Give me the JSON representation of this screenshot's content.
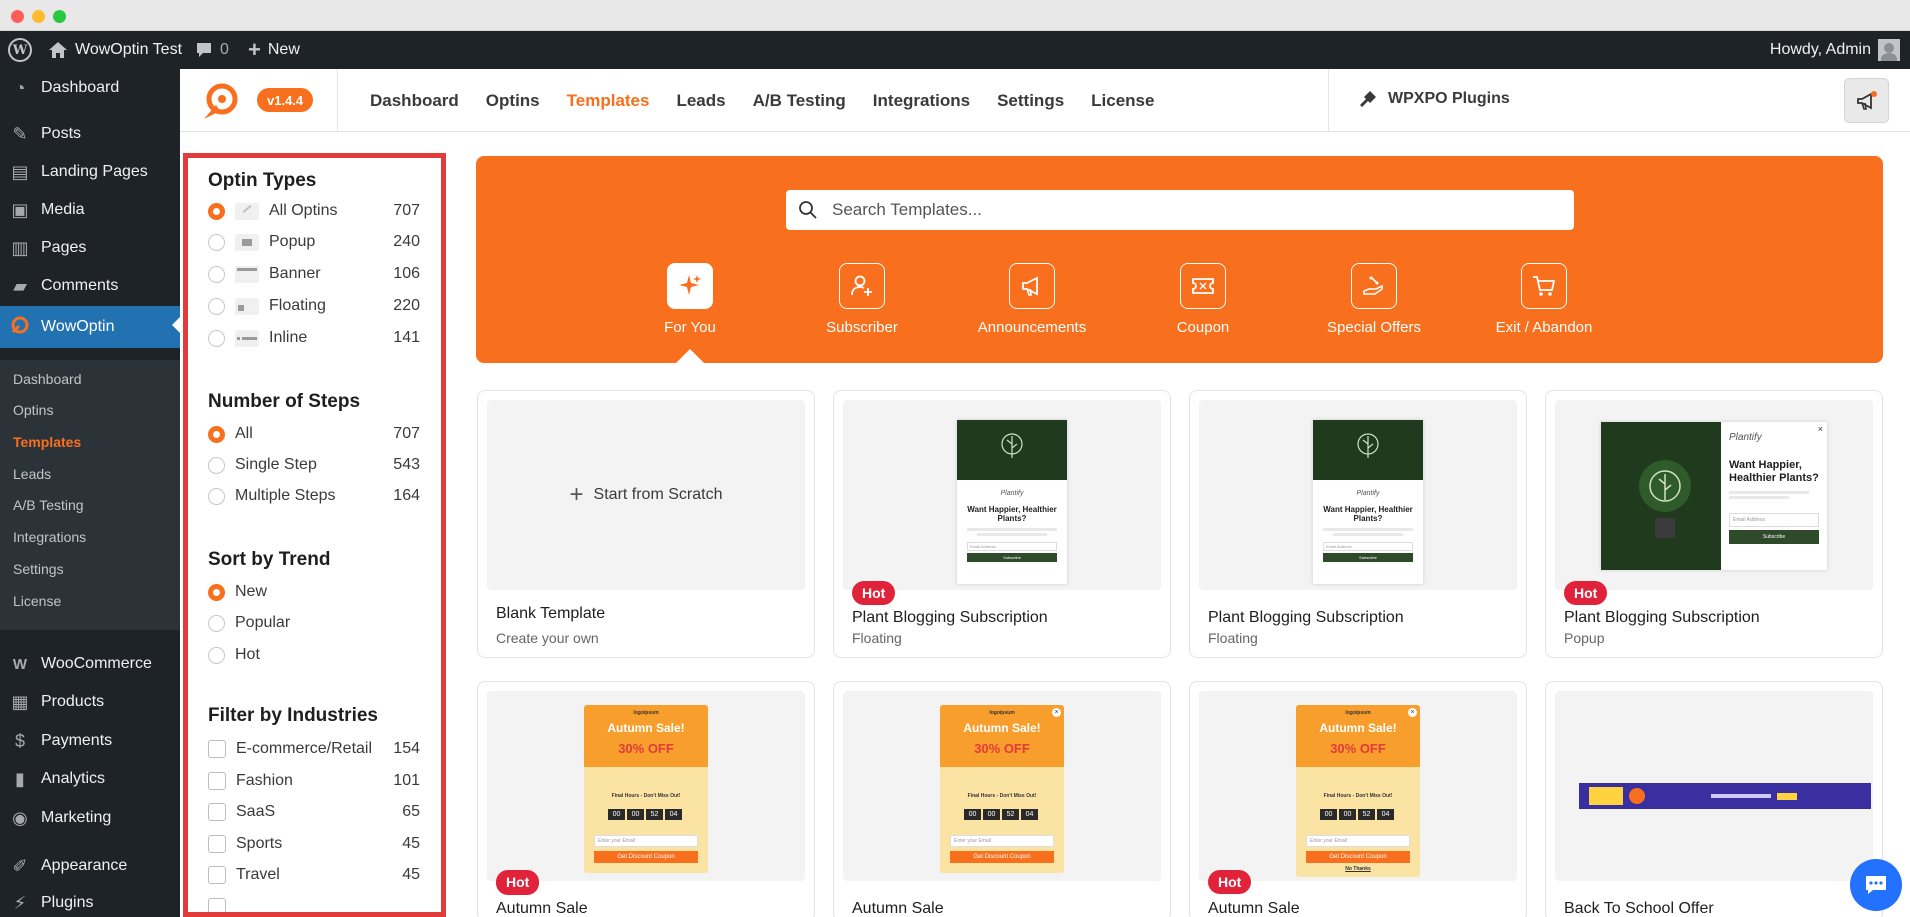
{
  "adminbar": {
    "site_name": "WowOptin Test",
    "comments_count": "0",
    "new_label": "New",
    "howdy": "Howdy, Admin"
  },
  "wp_menu": {
    "items": [
      {
        "label": "Dashboard",
        "icon": "dashboard-icon"
      },
      {
        "label": "Posts",
        "icon": "pin-icon"
      },
      {
        "label": "Landing Pages",
        "icon": "pages-icon"
      },
      {
        "label": "Media",
        "icon": "media-icon"
      },
      {
        "label": "Pages",
        "icon": "page-icon"
      },
      {
        "label": "Comments",
        "icon": "comment-icon"
      },
      {
        "label": "WowOptin",
        "icon": "wowoptin-icon"
      }
    ],
    "submenu": [
      "Dashboard",
      "Optins",
      "Templates",
      "Leads",
      "A/B Testing",
      "Integrations",
      "Settings",
      "License"
    ],
    "items2": [
      {
        "label": "WooCommerce",
        "icon": "woocommerce-icon"
      },
      {
        "label": "Products",
        "icon": "products-icon"
      },
      {
        "label": "Payments",
        "icon": "payments-icon"
      },
      {
        "label": "Analytics",
        "icon": "analytics-icon"
      },
      {
        "label": "Marketing",
        "icon": "marketing-icon"
      },
      {
        "label": "Appearance",
        "icon": "appearance-icon"
      },
      {
        "label": "Plugins",
        "icon": "plugins-icon"
      }
    ]
  },
  "plugin_header": {
    "version": "v1.4.4",
    "tabs": [
      "Dashboard",
      "Optins",
      "Templates",
      "Leads",
      "A/B Testing",
      "Integrations",
      "Settings",
      "License"
    ],
    "active_tab": "Templates",
    "wpxpo": "WPXPO Plugins"
  },
  "filters": {
    "optin_types_title": "Optin Types",
    "optin_types": [
      {
        "label": "All Optins",
        "count": "707",
        "selected": true
      },
      {
        "label": "Popup",
        "count": "240"
      },
      {
        "label": "Banner",
        "count": "106"
      },
      {
        "label": "Floating",
        "count": "220"
      },
      {
        "label": "Inline",
        "count": "141"
      }
    ],
    "steps_title": "Number of Steps",
    "steps": [
      {
        "label": "All",
        "count": "707",
        "selected": true
      },
      {
        "label": "Single Step",
        "count": "543"
      },
      {
        "label": "Multiple Steps",
        "count": "164"
      }
    ],
    "trend_title": "Sort by Trend",
    "trend": [
      {
        "label": "New",
        "selected": true
      },
      {
        "label": "Popular"
      },
      {
        "label": "Hot"
      }
    ],
    "industries_title": "Filter by Industries",
    "industries": [
      {
        "label": "E-commerce/Retail",
        "count": "154"
      },
      {
        "label": "Fashion",
        "count": "101"
      },
      {
        "label": "SaaS",
        "count": "65"
      },
      {
        "label": "Sports",
        "count": "45"
      },
      {
        "label": "Travel",
        "count": "45"
      }
    ]
  },
  "banner": {
    "search_placeholder": "Search Templates...",
    "categories": [
      {
        "label": "For You",
        "icon": "sparkle-icon"
      },
      {
        "label": "Subscriber",
        "icon": "user-plus-icon"
      },
      {
        "label": "Announcements",
        "icon": "megaphone-icon"
      },
      {
        "label": "Coupon",
        "icon": "coupon-icon"
      },
      {
        "label": "Special Offers",
        "icon": "offer-icon"
      },
      {
        "label": "Exit / Abandon",
        "icon": "cart-icon"
      }
    ]
  },
  "templates": {
    "hot_label": "Hot",
    "start_from_scratch": "Start from Scratch",
    "cards": [
      {
        "title": "Blank Template",
        "subtitle": "Create your own"
      },
      {
        "title": "Plant Blogging Subscription",
        "subtitle": "Floating",
        "hot": true
      },
      {
        "title": "Plant Blogging Subscription",
        "subtitle": "Floating"
      },
      {
        "title": "Plant Blogging Subscription",
        "subtitle": "Popup",
        "hot": true
      },
      {
        "title": "Autumn Sale",
        "hot": true
      },
      {
        "title": "Autumn Sale"
      },
      {
        "title": "Autumn Sale",
        "hot": true
      },
      {
        "title": "Back To School Offer"
      }
    ],
    "plant_preview": {
      "brand": "Plantify",
      "headline": "Want Happier, Healthier Plants?",
      "email_placeholder": "Email Address",
      "button": "Subscribe"
    },
    "autumn_preview": {
      "brand": "logoipsum",
      "title": "Autumn Sale!",
      "discount": "30% OFF",
      "final_hours": "Final Hours - Don't Miss Out!",
      "digits": [
        "00",
        "00",
        "52",
        "04"
      ],
      "email_placeholder": "Enter your Email",
      "button": "Get Discount Coupon",
      "no_thanks": "No Thanks"
    }
  },
  "colors": {
    "accent": "#f86f1d",
    "wp_dark": "#1d2327",
    "wp_blue": "#2271b1",
    "hot": "#e0223a",
    "highlight_border": "#e23b3b"
  }
}
